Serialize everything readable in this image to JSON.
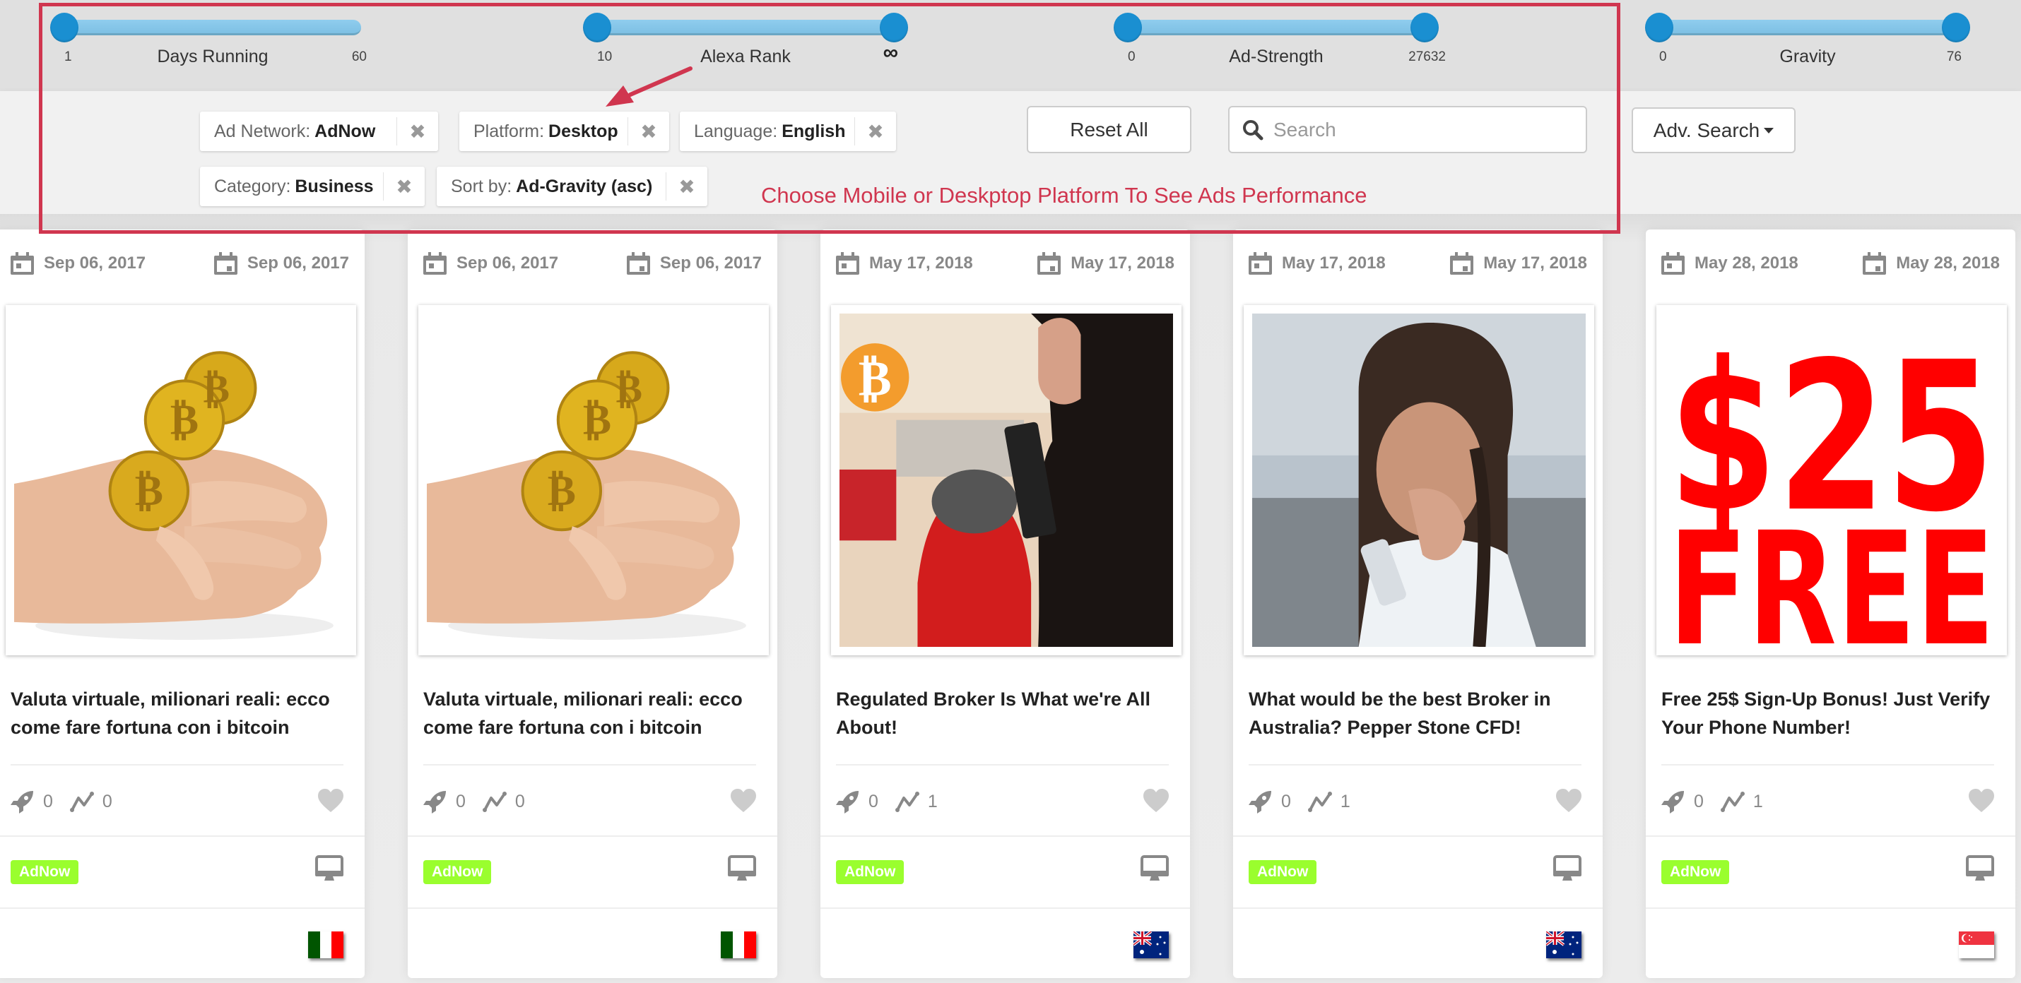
{
  "sliders": [
    {
      "name": "days-running",
      "title": "Days Running",
      "min": "1",
      "max": "60",
      "low": 0.0,
      "high": null
    },
    {
      "name": "alexa-rank",
      "title": "Alexa Rank",
      "min": "10",
      "max": "∞",
      "low": 0.0,
      "high": 1.0
    },
    {
      "name": "ad-strength",
      "title": "Ad-Strength",
      "min": "0",
      "max": "27632",
      "low": 0.0,
      "high": 1.0
    },
    {
      "name": "gravity",
      "title": "Gravity",
      "min": "0",
      "max": "76",
      "low": 0.0,
      "high": 1.0
    }
  ],
  "filters": [
    {
      "label": "Ad Network:",
      "value": "AdNow"
    },
    {
      "label": "Platform:",
      "value": "Desktop"
    },
    {
      "label": "Language:",
      "value": "English"
    },
    {
      "label": "Category:",
      "value": "Business"
    },
    {
      "label": "Sort by:",
      "value": "Ad-Gravity (asc)"
    }
  ],
  "toolbar": {
    "reset_label": "Reset All",
    "search_placeholder": "Search",
    "search_value": "",
    "adv_search_label": "Adv. Search"
  },
  "annotation": {
    "message": "Choose Mobile or Deskptop Platform To See Ads Performance",
    "color": "#d0364f"
  },
  "colors": {
    "slider_handle": "#1a8fd1",
    "slider_track": "#8fcdee",
    "badge": "#9afe2e",
    "icon_gray": "#888888"
  },
  "cards": [
    {
      "start_date": "Sep 06, 2017",
      "end_date": "Sep 06, 2017",
      "image": "bitcoin-hand",
      "title": "Valuta virtuale, milionari reali: ecco come fare fortuna con i bitcoin",
      "rocket": "0",
      "trend": "0",
      "network": "AdNow",
      "platform_icon": "desktop-icon",
      "country": "Italy"
    },
    {
      "start_date": "Sep 06, 2017",
      "end_date": "Sep 06, 2017",
      "image": "bitcoin-hand",
      "title": "Valuta virtuale, milionari reali: ecco come fare fortuna con i bitcoin",
      "rocket": "0",
      "trend": "0",
      "network": "AdNow",
      "platform_icon": "desktop-icon",
      "country": "Italy"
    },
    {
      "start_date": "May 17, 2018",
      "end_date": "May 17, 2018",
      "image": "bitcoin-car-phone",
      "title": "Regulated Broker Is What we're All About!",
      "rocket": "0",
      "trend": "1",
      "network": "AdNow",
      "platform_icon": "desktop-icon",
      "country": "Australia"
    },
    {
      "start_date": "May 17, 2018",
      "end_date": "May 17, 2018",
      "image": "crying-woman-phone",
      "title": "What would be the best Broker in Australia? Pepper Stone CFD!",
      "rocket": "0",
      "trend": "1",
      "network": "AdNow",
      "platform_icon": "desktop-icon",
      "country": "Australia"
    },
    {
      "start_date": "May 28, 2018",
      "end_date": "May 28, 2018",
      "image": "25-free",
      "image_text": [
        "$25",
        "FREE"
      ],
      "title": "Free 25$ Sign-Up Bonus! Just Verify Your Phone Number!",
      "rocket": "0",
      "trend": "1",
      "network": "AdNow",
      "platform_icon": "desktop-icon",
      "country": "Singapore"
    }
  ]
}
